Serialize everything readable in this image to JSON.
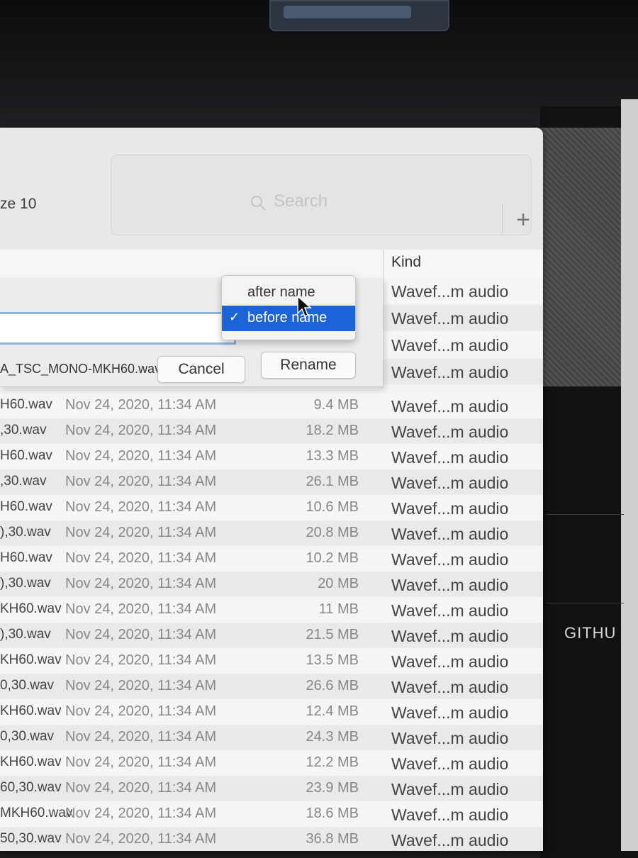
{
  "window": {
    "title": "ze 10"
  },
  "search": {
    "placeholder": "Search",
    "add_label": "+"
  },
  "columns": {
    "kind": "Kind"
  },
  "dialog": {
    "position_options": [
      {
        "label": "after name",
        "selected": false
      },
      {
        "label": "before name",
        "selected": true
      }
    ],
    "check_mark": "✓",
    "example_name": "A_TSC_MONO-MKH60.wav",
    "cancel_label": "Cancel",
    "rename_label": "Rename"
  },
  "dialog_rows_kind": [
    "Wavef...m audio",
    "Wavef...m audio",
    "Wavef...m audio",
    "Wavef...m audio"
  ],
  "files": [
    {
      "name": "H60.wav",
      "date": "Nov 24, 2020, 11:34 AM",
      "size": "9.4 MB",
      "kind": "Wavef...m audio"
    },
    {
      "name": ",30.wav",
      "date": "Nov 24, 2020, 11:34 AM",
      "size": "18.2 MB",
      "kind": "Wavef...m audio"
    },
    {
      "name": "H60.wav",
      "date": "Nov 24, 2020, 11:34 AM",
      "size": "13.3 MB",
      "kind": "Wavef...m audio"
    },
    {
      "name": ",30.wav",
      "date": "Nov 24, 2020, 11:34 AM",
      "size": "26.1 MB",
      "kind": "Wavef...m audio"
    },
    {
      "name": "H60.wav",
      "date": "Nov 24, 2020, 11:34 AM",
      "size": "10.6 MB",
      "kind": "Wavef...m audio"
    },
    {
      "name": "),30.wav",
      "date": "Nov 24, 2020, 11:34 AM",
      "size": "20.8 MB",
      "kind": "Wavef...m audio"
    },
    {
      "name": "H60.wav",
      "date": "Nov 24, 2020, 11:34 AM",
      "size": "10.2 MB",
      "kind": "Wavef...m audio"
    },
    {
      "name": "),30.wav",
      "date": "Nov 24, 2020, 11:34 AM",
      "size": "20 MB",
      "kind": "Wavef...m audio"
    },
    {
      "name": "KH60.wav",
      "date": "Nov 24, 2020, 11:34 AM",
      "size": "11 MB",
      "kind": "Wavef...m audio"
    },
    {
      "name": "),30.wav",
      "date": "Nov 24, 2020, 11:34 AM",
      "size": "21.5 MB",
      "kind": "Wavef...m audio"
    },
    {
      "name": "KH60.wav",
      "date": "Nov 24, 2020, 11:34 AM",
      "size": "13.5 MB",
      "kind": "Wavef...m audio"
    },
    {
      "name": "0,30.wav",
      "date": "Nov 24, 2020, 11:34 AM",
      "size": "26.6 MB",
      "kind": "Wavef...m audio"
    },
    {
      "name": "KH60.wav",
      "date": "Nov 24, 2020, 11:34 AM",
      "size": "12.4 MB",
      "kind": "Wavef...m audio"
    },
    {
      "name": "0,30.wav",
      "date": "Nov 24, 2020, 11:34 AM",
      "size": "24.3 MB",
      "kind": "Wavef...m audio"
    },
    {
      "name": "KH60.wav",
      "date": "Nov 24, 2020, 11:34 AM",
      "size": "12.2 MB",
      "kind": "Wavef...m audio"
    },
    {
      "name": "60,30.wav",
      "date": "Nov 24, 2020, 11:34 AM",
      "size": "23.9 MB",
      "kind": "Wavef...m audio"
    },
    {
      "name": "MKH60.wav",
      "date": "Nov 24, 2020, 11:34 AM",
      "size": "18.6 MB",
      "kind": "Wavef...m audio"
    },
    {
      "name": "50,30.wav",
      "date": "Nov 24, 2020, 11:34 AM",
      "size": "36.8 MB",
      "kind": "Wavef...m audio"
    }
  ],
  "background_text": {
    "github": "GITHU"
  }
}
